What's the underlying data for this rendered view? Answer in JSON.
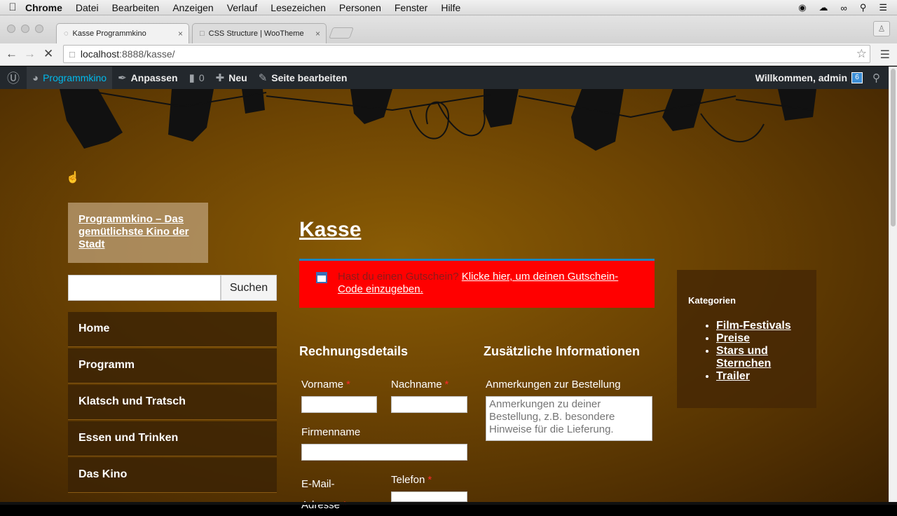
{
  "mac_menu": {
    "apple": "",
    "items": [
      "Chrome",
      "Datei",
      "Bearbeiten",
      "Anzeigen",
      "Verlauf",
      "Lesezeichen",
      "Personen",
      "Fenster",
      "Hilfe"
    ],
    "status_icons": [
      "record-icon",
      "creative-cloud-icon",
      "wifi-icon",
      "search-icon",
      "list-icon"
    ]
  },
  "tabs": [
    {
      "title": "Kasse Programmkino",
      "close": "×"
    },
    {
      "title": "CSS Structure | WooTheme",
      "close": "×"
    }
  ],
  "toolbar": {
    "url_host": "localhost",
    "url_rest": ":8888/kasse/"
  },
  "wp_admin_bar": {
    "site": "Programmkino",
    "customize": "Anpassen",
    "comments_count": "0",
    "new": "Neu",
    "edit": "Seite bearbeiten",
    "welcome": "Willkommen, admin"
  },
  "site": {
    "title": "Programmkino – Das gemütlichste Kino der Stadt",
    "search_button": "Suchen",
    "nav": [
      "Home",
      "Programm",
      "Klatsch und Tratsch",
      "Essen und Trinken",
      "Das Kino"
    ]
  },
  "page": {
    "title": "Kasse",
    "coupon_question": "Hast du einen Gutschein?",
    "coupon_link": "Klicke hier, um deinen Gutschein-Code einzugeben.",
    "billing_title": "Rechnungsdetails",
    "additional_title": "Zusätzliche Informationen",
    "fields": {
      "first_name": "Vorname",
      "last_name": "Nachname",
      "company": "Firmenname",
      "email_line1": "E-Mail-",
      "email_line2": "Adresse",
      "phone": "Telefon",
      "required_mark": "*"
    },
    "notes_label": "Anmerkungen zur Bestellung",
    "notes_placeholder": "Anmerkungen zu deiner Bestellung, z.B. besondere Hinweise für die Lieferung."
  },
  "sidebar_widget": {
    "title": "Kategorien",
    "items": [
      "Film-Festivals",
      "Preise",
      "Stars und Sternchen",
      "Trailer"
    ]
  },
  "colors": {
    "notice_bg": "#ff0000",
    "admin_bar": "#23282d",
    "accent": "#00b9eb"
  }
}
